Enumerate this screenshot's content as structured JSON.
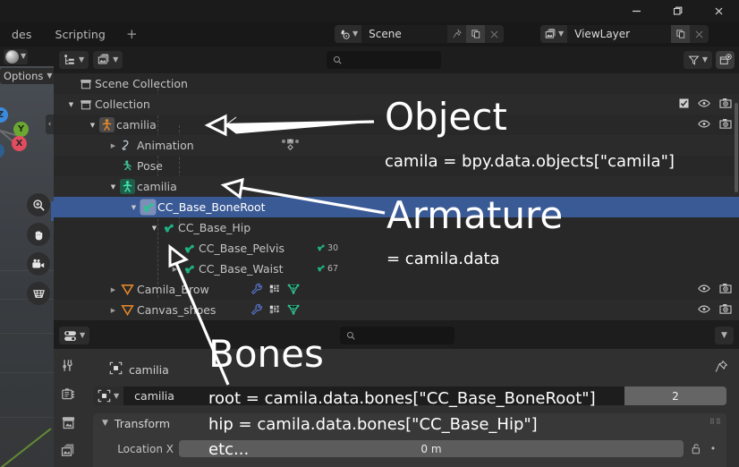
{
  "window": {
    "buttons": [
      {
        "name": "minimize",
        "glyph": "minimize-icon"
      },
      {
        "name": "maximize",
        "glyph": "maximize-icon"
      },
      {
        "name": "close",
        "glyph": "close-icon"
      }
    ]
  },
  "topbar": {
    "workspace_tabs": [
      {
        "label": "des",
        "active": false
      },
      {
        "label": "Scripting",
        "active": false
      }
    ],
    "add_workspace_label": "+",
    "scene": {
      "icon": "scene-icon",
      "value": "Scene",
      "pin_icon": "pin-icon",
      "copy_icon": "duplicate-icon",
      "close_icon": "close-icon"
    },
    "view_layer": {
      "icon": "view-layer-icon",
      "value": "ViewLayer",
      "copy_icon": "duplicate-icon",
      "close_icon": "close-icon"
    }
  },
  "viewport": {
    "shading_icon": "shading-sphere-icon",
    "options_label": "Options",
    "gizmo_axes": [
      {
        "label": "Z",
        "name": "axis-z"
      },
      {
        "label": "Y",
        "name": "axis-y"
      },
      {
        "label": "X",
        "name": "axis-x"
      }
    ],
    "nav_buttons": [
      {
        "name": "zoom-icon"
      },
      {
        "name": "pan-hand-icon"
      },
      {
        "name": "camera-view-icon"
      },
      {
        "name": "toggle-perspective-icon"
      }
    ],
    "sidebar_toggle": "chevron-left-icon"
  },
  "outliner": {
    "editor_type_icon": "outliner-editor-icon",
    "display_mode_icon": "view-layer-icon",
    "search": {
      "placeholder": "",
      "value": "",
      "icon": "search-icon"
    },
    "filter": {
      "icon": "filter-funnel-icon",
      "chevron": "chevron-down-icon"
    },
    "new_collection_icon": "new-collection-icon",
    "column_headers": {
      "checkbox": "checkbox-icon",
      "hide": "eye-icon",
      "render": "camera-icon"
    },
    "rows": [
      {
        "label": "Scene Collection",
        "icon": "scene-collection-icon",
        "icon_color": "#c0c0c0",
        "indent": 0,
        "disclose": "none",
        "selected": false,
        "alt": false,
        "right_icons": []
      },
      {
        "label": "Collection",
        "icon": "collection-icon",
        "icon_color": "#c0c0c0",
        "indent": 1,
        "disclose": "open",
        "selected": false,
        "alt": true,
        "right_icons": [
          "checkbox-checked",
          "eye",
          "camera"
        ]
      },
      {
        "label": "camilia",
        "icon": "armature-object-icon",
        "icon_color": "#e0852a",
        "indent": 2,
        "disclose": "open",
        "selected": false,
        "alt": false,
        "right_icons": [
          "eye",
          "camera"
        ]
      },
      {
        "label": "Animation",
        "icon": "animation-icon",
        "icon_color": "#9bb8c4",
        "indent": 3,
        "disclose": "closed",
        "selected": false,
        "alt": true,
        "right_icons": [],
        "extra": "keyframe-markers"
      },
      {
        "label": "Pose",
        "icon": "pose-icon",
        "icon_color": "#3ec49a",
        "indent": 3,
        "disclose": "none",
        "selected": false,
        "alt": false,
        "right_icons": []
      },
      {
        "label": "camilia",
        "icon": "armature-data-icon",
        "icon_color": "#3ec49a",
        "indent": 3,
        "disclose": "open",
        "selected": false,
        "alt": true,
        "right_icons": []
      },
      {
        "label": "CC_Base_BoneRoot",
        "icon": "bone-icon",
        "icon_color": "#3ec49a",
        "indent": 4,
        "disclose": "open",
        "selected": true,
        "alt": false,
        "right_icons": []
      },
      {
        "label": "CC_Base_Hip",
        "icon": "bone-icon",
        "icon_color": "#1fb183",
        "indent": 5,
        "disclose": "open",
        "selected": false,
        "alt": false,
        "right_icons": []
      },
      {
        "label": "CC_Base_Pelvis",
        "icon": "bone-icon",
        "icon_color": "#1fb183",
        "indent": 6,
        "disclose": "none",
        "selected": false,
        "alt": false,
        "right_icons": [],
        "bone_count": "30"
      },
      {
        "label": "CC_Base_Waist",
        "icon": "bone-icon",
        "icon_color": "#1fb183",
        "indent": 6,
        "disclose": "closed",
        "selected": false,
        "alt": false,
        "right_icons": [],
        "bone_count": "67"
      },
      {
        "label": "Camila_Brow",
        "icon": "mesh-object-icon",
        "icon_color": "#e0852a",
        "indent": 2,
        "disclose": "closed",
        "selected": false,
        "alt": false,
        "right_icons": [
          "eye",
          "camera"
        ],
        "data_icons": [
          "modifier-wrench-icon",
          "material-icon",
          "mesh-data-icon"
        ]
      },
      {
        "label": "Canvas_shoes",
        "icon": "mesh-object-icon",
        "icon_color": "#e0852a",
        "indent": 2,
        "disclose": "closed",
        "selected": false,
        "alt": true,
        "right_icons": [
          "eye",
          "camera"
        ],
        "data_icons": [
          "modifier-wrench-icon",
          "material-icon",
          "mesh-data-icon"
        ]
      }
    ]
  },
  "properties": {
    "editor_type_icon": "properties-editor-icon",
    "header_chevron": "chevron-down-icon",
    "search": {
      "placeholder": "",
      "value": "",
      "icon": "search-icon"
    },
    "tabs": [
      {
        "name": "tool-tab",
        "icon": "tool-icon"
      },
      {
        "name": "render-tab",
        "icon": "render-camera-icon"
      },
      {
        "name": "output-tab",
        "icon": "printer-icon"
      },
      {
        "name": "view-layer-tab",
        "icon": "images-icon"
      }
    ],
    "breadcrumb": {
      "icon": "object-data-icon",
      "label": "camilia"
    },
    "pin_icon": "pin-icon",
    "datablock": {
      "icon": "object-data-icon",
      "chevron": "chevron-down-icon",
      "value": "camilia",
      "users_count": "2"
    },
    "panel": {
      "title": "Transform",
      "chevron": "chevron-down-icon",
      "grip": "grip-dots-icon",
      "fields": [
        {
          "label": "Location X",
          "value": "0 m",
          "lock": "unlock-icon",
          "animate": "animate-dot-icon"
        }
      ]
    }
  },
  "annotations": {
    "labels": [
      {
        "text": "Object",
        "name": "annotation-object-label"
      },
      {
        "text": "Armature",
        "name": "annotation-armature-label"
      },
      {
        "text": "Bones",
        "name": "annotation-bones-label"
      }
    ],
    "code_lines": [
      {
        "text": "camila = bpy.data.objects[\"camila\"]",
        "name": "annotation-object-code"
      },
      {
        "text": "= camila.data",
        "name": "annotation-armature-code"
      },
      {
        "text": "root = camila.data.bones[\"CC_Base_BoneRoot\"]",
        "name": "annotation-bones-code-root"
      },
      {
        "text": "hip = camila.data.bones[\"CC_Base_Hip\"]",
        "name": "annotation-bones-code-hip"
      },
      {
        "text": "etc...",
        "name": "annotation-bones-code-etc"
      }
    ],
    "arrows": [
      {
        "name": "arrow-to-object"
      },
      {
        "name": "arrow-to-armature"
      },
      {
        "name": "arrow-to-bones"
      }
    ]
  },
  "colors": {
    "selection_blue": "#3a5a96",
    "object_orange": "#e0852a",
    "armature_green": "#3ec49a",
    "axis_x": "#e34b5e",
    "axis_y": "#6aa832",
    "axis_z": "#3c8ade",
    "background": "#282828"
  }
}
